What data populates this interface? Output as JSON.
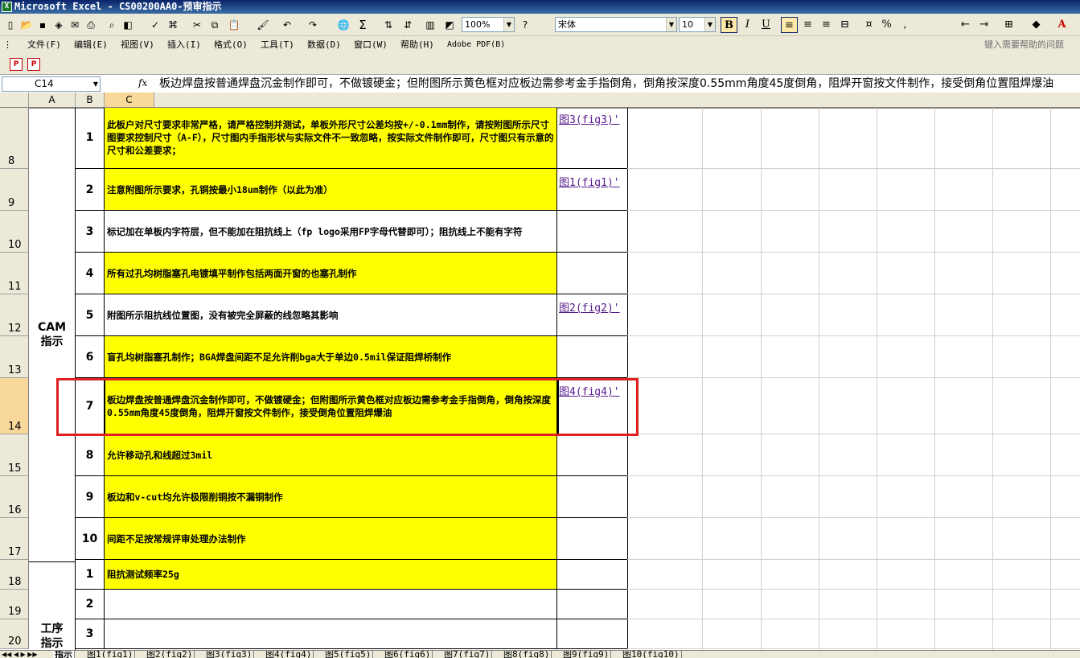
{
  "window": {
    "title": "Microsoft Excel - CS00200AA0-预审指示"
  },
  "toolbar": {
    "zoom": "100%",
    "font": "宋体",
    "font_size": "10",
    "bold": "B",
    "italic": "I",
    "underline": "U",
    "sum": "Σ",
    "percent": "%",
    "comma": ",",
    "font_color": "A"
  },
  "menu": {
    "items": [
      "文件(F)",
      "编辑(E)",
      "视图(V)",
      "插入(I)",
      "格式(O)",
      "工具(T)",
      "数据(D)",
      "窗口(W)",
      "帮助(H)",
      "Adobe PDF(B)"
    ],
    "help_placeholder": "键入需要帮助的问题"
  },
  "formula_bar": {
    "name_box": "C14",
    "fx": "fx",
    "content": "板边焊盘按普通焊盘沉金制作即可，不做镀硬金；但附图所示黄色框对应板边需参考金手指倒角，倒角按深度0.55mm角度45度倒角，阻焊开窗按文件制作，接受倒角位置阻焊爆油"
  },
  "columns": [
    "A",
    "B",
    "C"
  ],
  "rows": [
    "8",
    "9",
    "10",
    "11",
    "12",
    "13",
    "14",
    "15",
    "16",
    "17",
    "18",
    "19",
    "20"
  ],
  "groups": {
    "cam": "CAM\n指示",
    "process": "工序\n指示"
  },
  "table": [
    {
      "num": "1",
      "text": "此板户对尺寸要求非常严格，请严格控制并测试，单板外形尺寸公差均按+/-0.1mm制作，请按附图所示尺寸图要求控制尺寸（A-F），尺寸图内手指形状与实际文件不一致忽略，按实际文件制作即可，尺寸图只有示意的尺寸和公差要求；",
      "link": "图3(fig3)'",
      "yellow": true
    },
    {
      "num": "2",
      "text": "注意附图所示要求，孔铜按最小18um制作（以此为准）",
      "link": "图1(fig1)'",
      "yellow": true
    },
    {
      "num": "3",
      "text": "标记加在单板内字符层，但不能加在阻抗线上（fp logo采用FP字母代替即可）；阻抗线上不能有字符",
      "link": "",
      "yellow": false
    },
    {
      "num": "4",
      "text": "所有过孔均树脂塞孔电镀填平制作包括两面开窗的也塞孔制作",
      "link": "",
      "yellow": true
    },
    {
      "num": "5",
      "text": "附图所示阻抗线位置图，没有被完全屏蔽的线忽略其影响",
      "link": "图2(fig2)'",
      "yellow": false
    },
    {
      "num": "6",
      "text": "盲孔均树脂塞孔制作；BGA焊盘间距不足允许削bga大于单边0.5mil保证阻焊桥制作",
      "link": "",
      "yellow": true
    },
    {
      "num": "7",
      "text": "板边焊盘按普通焊盘沉金制作即可，不做镀硬金；但附图所示黄色框对应板边需参考金手指倒角，倒角按深度0.55mm角度45度倒角，阻焊开窗按文件制作，接受倒角位置阻焊爆油",
      "link": "图4(fig4)'",
      "yellow": true
    },
    {
      "num": "8",
      "text": "允许移动孔和线超过3mil",
      "link": "",
      "yellow": true
    },
    {
      "num": "9",
      "text": "板边和v-cut均允许极限削铜按不漏铜制作",
      "link": "",
      "yellow": true
    },
    {
      "num": "10",
      "text": "间距不足按常规评审处理办法制作",
      "link": "",
      "yellow": true
    },
    {
      "num": "1",
      "text": "阻抗测试频率25g",
      "link": "",
      "yellow": true
    },
    {
      "num": "2",
      "text": "",
      "link": "",
      "yellow": false
    },
    {
      "num": "3",
      "text": "",
      "link": "",
      "yellow": false
    }
  ],
  "sheet_tabs": [
    "指示",
    "图1(fig1)",
    "图2(fig2)",
    "图3(fig3)",
    "图4(fig4)",
    "图5(fig5)",
    "图6(fig6)",
    "图7(fig7)",
    "图8(fig8)",
    "图9(fig9)",
    "图10(fig10)"
  ],
  "colors": {
    "highlight": "#ffff00",
    "annotation": "#e02020",
    "link": "#551a8b"
  }
}
